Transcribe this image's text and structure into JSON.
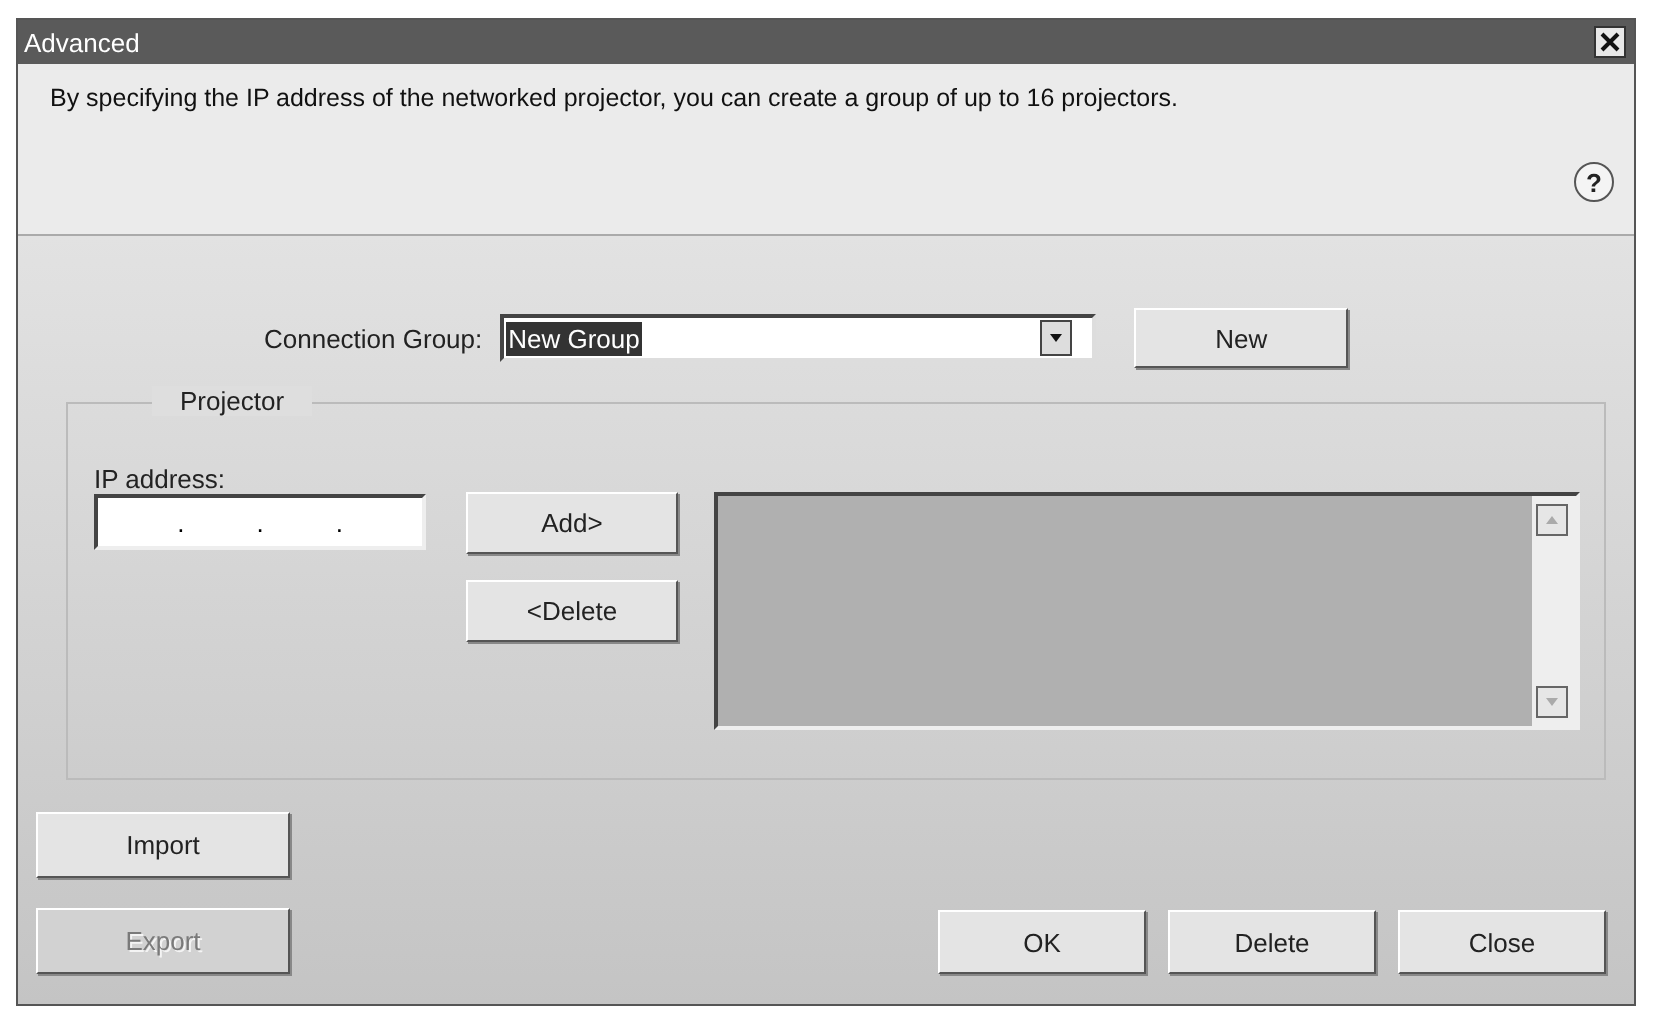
{
  "window": {
    "title": "Advanced"
  },
  "description": "By specifying the IP address of the networked projector, you can create a group of up to 16 projectors.",
  "help_button": "?",
  "connection_group": {
    "label": "Connection Group:",
    "value": "New Group",
    "button": "New"
  },
  "projector_group": {
    "title": "Projector",
    "ip_label": "IP address:",
    "ip_separators": [
      ".",
      ".",
      "."
    ],
    "buttons": [
      {
        "label": "Add>",
        "disabled": false
      },
      {
        "label": "<Delete",
        "disabled": false
      }
    ]
  },
  "side_buttons": [
    {
      "label": "Import",
      "disabled": false
    },
    {
      "label": "Export",
      "disabled": true
    }
  ],
  "buttons": [
    {
      "label": "OK",
      "disabled": false
    },
    {
      "label": "Delete",
      "disabled": false
    },
    {
      "label": "Close",
      "disabled": false
    }
  ]
}
